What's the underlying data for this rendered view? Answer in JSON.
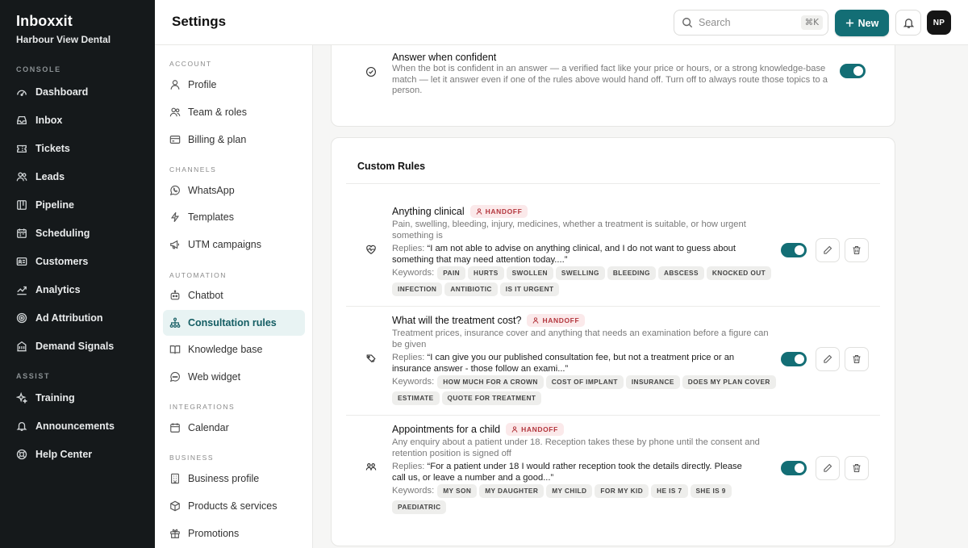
{
  "brand": {
    "name": "Inboxxit",
    "workspace": "Harbour View Dental"
  },
  "sidebar": {
    "sections": [
      {
        "label": "CONSOLE",
        "items": [
          {
            "label": "Dashboard",
            "icon": "dashboard-icon"
          },
          {
            "label": "Inbox",
            "icon": "inbox-icon"
          },
          {
            "label": "Tickets",
            "icon": "ticket-icon"
          },
          {
            "label": "Leads",
            "icon": "users-icon"
          },
          {
            "label": "Pipeline",
            "icon": "kanban-icon"
          },
          {
            "label": "Scheduling",
            "icon": "calendar-icon"
          },
          {
            "label": "Customers",
            "icon": "id-card-icon"
          },
          {
            "label": "Analytics",
            "icon": "trend-icon"
          },
          {
            "label": "Ad Attribution",
            "icon": "target-icon"
          },
          {
            "label": "Demand Signals",
            "icon": "building-icon"
          }
        ]
      },
      {
        "label": "ASSIST",
        "items": [
          {
            "label": "Training",
            "icon": "sparkle-icon"
          },
          {
            "label": "Announcements",
            "icon": "bell-icon"
          },
          {
            "label": "Help Center",
            "icon": "lifebuoy-icon"
          }
        ]
      }
    ]
  },
  "header": {
    "title": "Settings",
    "search_placeholder": "Search",
    "search_shortcut": "⌘K",
    "new_label": "New",
    "avatar_initials": "NP"
  },
  "settings_nav": {
    "sections": [
      {
        "label": "ACCOUNT",
        "items": [
          "Profile",
          "Team & roles",
          "Billing & plan"
        ]
      },
      {
        "label": "CHANNELS",
        "items": [
          "WhatsApp",
          "Templates",
          "UTM campaigns"
        ]
      },
      {
        "label": "AUTOMATION",
        "items": [
          "Chatbot",
          "Consultation rules",
          "Knowledge base",
          "Web widget"
        ]
      },
      {
        "label": "INTEGRATIONS",
        "items": [
          "Calendar"
        ]
      },
      {
        "label": "BUSINESS",
        "items": [
          "Business profile",
          "Products & services",
          "Promotions"
        ]
      }
    ],
    "active": "Consultation rules"
  },
  "answer_confident": {
    "title": "Answer when confident",
    "description": "When the bot is confident in an answer — a verified fact like your price or hours, or a strong knowledge-base match — let it answer even if one of the rules above would hand off. Turn off to always route those topics to a person.",
    "enabled": true
  },
  "custom_rules": {
    "title": "Custom Rules",
    "replies_label": "Replies:",
    "keywords_label": "Keywords:",
    "rules": [
      {
        "title": "Anything clinical",
        "badge": "HANDOFF",
        "description": "Pain, swelling, bleeding, injury, medicines, whether a treatment is suitable, or how urgent something is",
        "reply": "“I am not able to advise on anything clinical, and I do not want to guess about something that may need attention today....”",
        "keywords": [
          "PAIN",
          "HURTS",
          "SWOLLEN",
          "SWELLING",
          "BLEEDING",
          "ABSCESS",
          "KNOCKED OUT",
          "INFECTION",
          "ANTIBIOTIC",
          "IS IT URGENT"
        ],
        "enabled": true
      },
      {
        "title": "What will the treatment cost?",
        "badge": "HANDOFF",
        "description": "Treatment prices, insurance cover and anything that needs an examination before a figure can be given",
        "reply": "“I can give you our published consultation fee, but not a treatment price or an insurance answer - those follow an exami...”",
        "keywords": [
          "HOW MUCH FOR A CROWN",
          "COST OF IMPLANT",
          "INSURANCE",
          "DOES MY PLAN COVER",
          "ESTIMATE",
          "QUOTE FOR TREATMENT"
        ],
        "enabled": true
      },
      {
        "title": "Appointments for a child",
        "badge": "HANDOFF",
        "description": "Any enquiry about a patient under 18. Reception takes these by phone until the consent and retention position is signed off",
        "reply": "“For a patient under 18 I would rather reception took the details directly. Please call us, or leave a number and a good...”",
        "keywords": [
          "MY SON",
          "MY DAUGHTER",
          "MY CHILD",
          "FOR MY KID",
          "HE IS 7",
          "SHE IS 9",
          "PAEDIATRIC"
        ],
        "enabled": true
      }
    ]
  }
}
